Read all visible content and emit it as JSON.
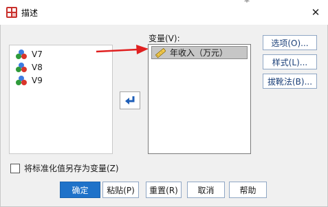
{
  "window": {
    "title": "描述",
    "close_glyph": "✕",
    "top_mark": "平"
  },
  "source_list": {
    "items": [
      {
        "label": "V7",
        "icon": "nominal-variable-icon"
      },
      {
        "label": "V8",
        "icon": "nominal-variable-icon"
      },
      {
        "label": "V9",
        "icon": "nominal-variable-icon"
      }
    ]
  },
  "target": {
    "label": "变量(V):",
    "items": [
      {
        "label": "年收入（万元）",
        "icon": "scale-ruler-icon"
      }
    ]
  },
  "buttons": {
    "options": "选项(O)...",
    "style": "样式(L)...",
    "bootstrap": "拔靴法(B)...",
    "ok": "确定",
    "paste": "粘贴(P)",
    "reset": "重置(R)",
    "cancel": "取消",
    "help": "帮助"
  },
  "checkbox": {
    "label": "将标准化值另存为变量(Z)",
    "checked": false
  },
  "colors": {
    "accent": "#1f72c9",
    "annotation_arrow": "#e02020",
    "selection": "#c6c6c6"
  }
}
